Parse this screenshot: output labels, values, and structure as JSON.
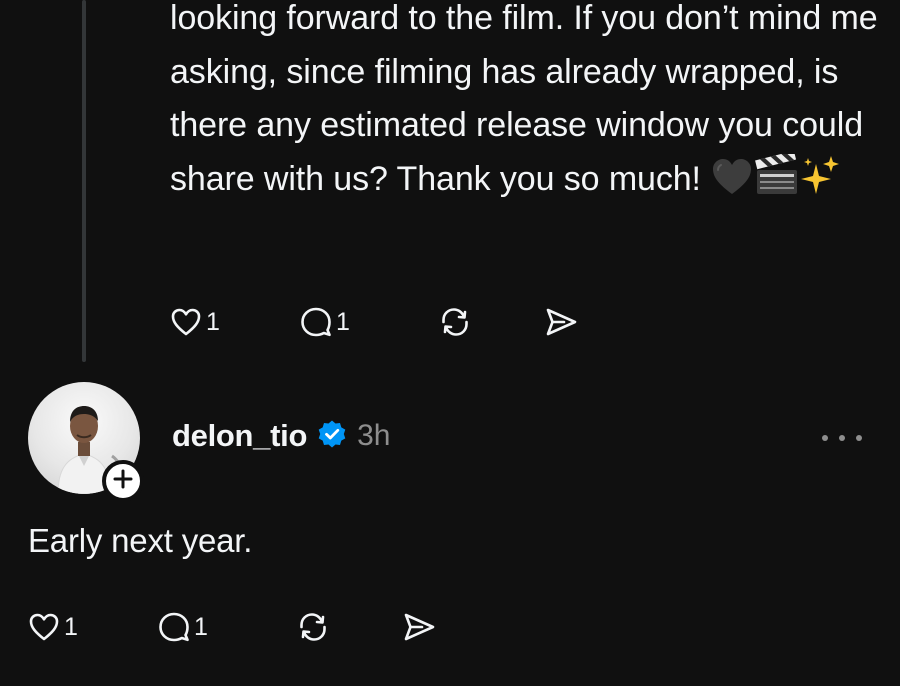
{
  "previous_post": {
    "text": "looking forward to the film. If you don’t mind me asking, since filming has already wrapped, is there any estimated release window you could share with us? Thank you so much!",
    "emojis": [
      "black-heart",
      "clapper-board",
      "sparkles"
    ],
    "like_count": "1",
    "reply_count": "1"
  },
  "reply_post": {
    "username": "delon_tio",
    "verified": true,
    "timestamp": "3h",
    "text": "Early next year.",
    "like_count": "1",
    "reply_count": "1"
  },
  "icons": {
    "like": "heart-icon",
    "reply": "comment-icon",
    "repost": "repost-icon",
    "share": "send-icon",
    "more": "more-dots-icon",
    "follow": "plus-icon",
    "verified": "verified-badge-icon"
  },
  "colors": {
    "background": "#101010",
    "text": "#f3f5f7",
    "muted": "#8e8e8e",
    "verified": "#0095f6",
    "thread_line": "#333638"
  }
}
